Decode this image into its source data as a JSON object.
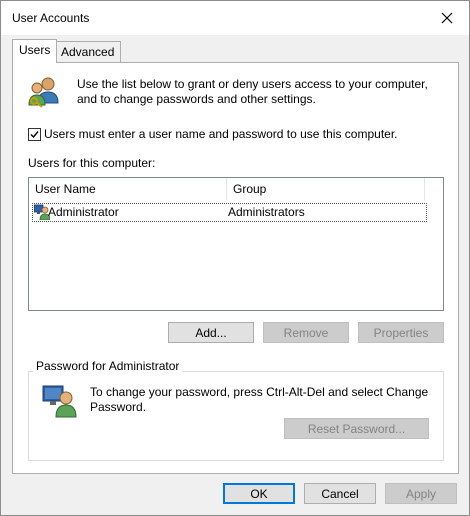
{
  "window": {
    "title": "User Accounts"
  },
  "tabs": [
    {
      "label": "Users",
      "active": true
    },
    {
      "label": "Advanced",
      "active": false
    }
  ],
  "users_tab": {
    "intro_text": "Use the list below to grant or deny users access to your computer, and to change passwords and other settings.",
    "require_login_checkbox": {
      "checked": true,
      "label": "Users must enter a user name and password to use this computer."
    },
    "users_list_label": "Users for this computer:",
    "users_table": {
      "columns": [
        "User Name",
        "Group"
      ],
      "rows": [
        {
          "user_name": "Administrator",
          "group": "Administrators",
          "selected": true
        }
      ]
    },
    "buttons": {
      "add": "Add...",
      "remove": "Remove",
      "properties": "Properties"
    },
    "password_group": {
      "title": "Password for Administrator",
      "text": "To change your password, press Ctrl-Alt-Del and select Change Password.",
      "reset_button": "Reset Password..."
    }
  },
  "footer": {
    "ok": "OK",
    "cancel": "Cancel",
    "apply": "Apply"
  },
  "icons": [
    "users-icon",
    "user-row-icon",
    "user-monitor-icon",
    "close-icon"
  ]
}
